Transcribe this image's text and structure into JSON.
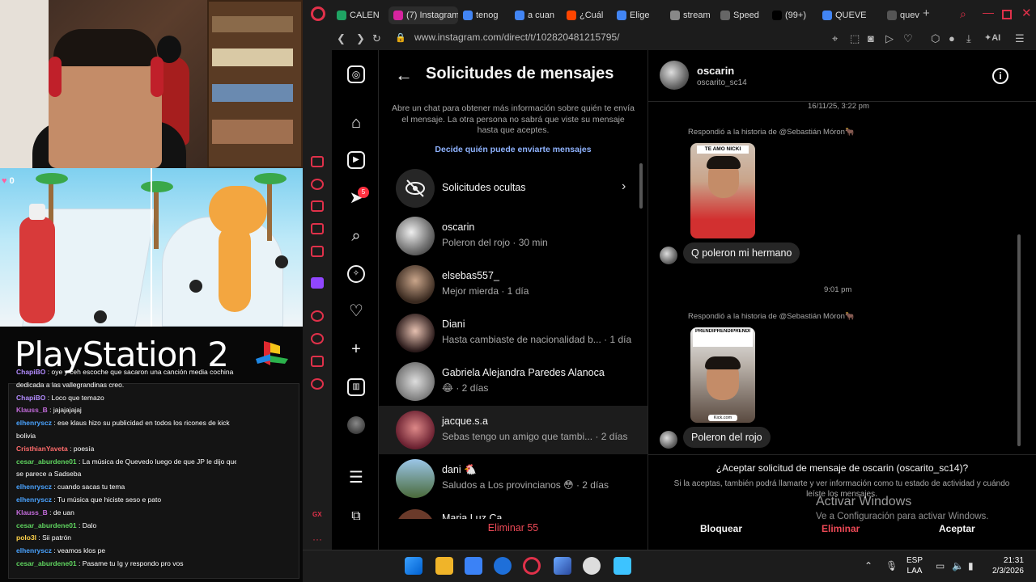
{
  "stream_overlay": {
    "game_counter": "0",
    "ps2_logo_text": "PlayStation 2",
    "chat": [
      {
        "user": "ChapiBO",
        "text": "oye y ceh escoche que sacaron una canción media cochina",
        "color": "#b38cff"
      },
      {
        "user": "",
        "text": "dedicada a las vallegrandinas creo.",
        "color": "#b38cff"
      },
      {
        "user": "ChapiBO",
        "text": "Loco que temazo",
        "color": "#b38cff"
      },
      {
        "user": "Klauss_B",
        "text": "jajajajajaj",
        "color": "#c26bd9"
      },
      {
        "user": "elhenryscz",
        "text": "ese klaus hizo su publicidad en todos los ricones de kick",
        "color": "#4aa3ff"
      },
      {
        "user": "",
        "text": "bolivia",
        "color": "#4aa3ff"
      },
      {
        "user": "CristhianYaveta",
        "text": "poesía",
        "color": "#ff6b6b"
      },
      {
        "user": "cesar_aburdene01",
        "text": "La música de Quevedo luego de que JP le dijo que",
        "color": "#5fd35f"
      },
      {
        "user": "",
        "text": "se parece a Sadseba",
        "color": "#5fd35f"
      },
      {
        "user": "elhenryscz",
        "text": "cuando sacas tu tema",
        "color": "#4aa3ff"
      },
      {
        "user": "elhenryscz",
        "text": "Tu música que hiciste seso e pato",
        "color": "#4aa3ff"
      },
      {
        "user": "Klauss_B",
        "text": "de uan",
        "color": "#c26bd9"
      },
      {
        "user": "cesar_aburdene01",
        "text": "Dalo",
        "color": "#5fd35f"
      },
      {
        "user": "polo3l",
        "text": "Sii patrón",
        "color": "#ffd24a"
      },
      {
        "user": "elhenryscz",
        "text": "veamos klos pe",
        "color": "#4aa3ff"
      },
      {
        "user": "cesar_aburdene01",
        "text": "Pasame tu Ig y respondo pro vos",
        "color": "#5fd35f"
      }
    ]
  },
  "browser": {
    "tabs": [
      {
        "label": "CALEN",
        "color": "#1fa463"
      },
      {
        "label": "(7) Instagram",
        "color": "#d6249f",
        "active": true
      },
      {
        "label": "tenog",
        "color": "#4285f4"
      },
      {
        "label": "a cuan",
        "color": "#4285f4"
      },
      {
        "label": "¿Cuál",
        "color": "#ff4500"
      },
      {
        "label": "Elige",
        "color": "#4285f4"
      },
      {
        "label": "stream",
        "color": "#888888"
      },
      {
        "label": "Speed",
        "color": "#666666"
      },
      {
        "label": "(99+)",
        "color": "#000000"
      },
      {
        "label": "QUEVE",
        "color": "#4285f4"
      },
      {
        "label": "queve",
        "color": "#555555"
      }
    ],
    "url": "www.instagram.com/direct/t/102820481215795/",
    "ai_label": "AI"
  },
  "instagram": {
    "notif_badge": "5",
    "requests": {
      "title": "Solicitudes de mensajes",
      "description": "Abre un chat para obtener más información sobre quién te envía el mensaje. La otra persona no sabrá que viste su mensaje hasta que aceptes.",
      "settings_link": "Decide quién puede enviarte mensajes",
      "hidden_label": "Solicitudes ocultas",
      "items": [
        {
          "name": "oscarin",
          "preview": "Poleron del rojo · 30 min",
          "avatar": "radial-gradient(circle at 40% 40%,#eee,#777 55%,#222)"
        },
        {
          "name": "elsebas557_",
          "preview": "Mejor mierda · 1 día",
          "avatar": "radial-gradient(circle at 50% 40%,#c9a58a,#3a2a20 70%)"
        },
        {
          "name": "Diani",
          "preview": "Hasta cambiaste de nacionalidad b... · 1 día",
          "avatar": "radial-gradient(circle at 50% 45%,#e6c0b0,#2a1a1a 70%)"
        },
        {
          "name": "Gabriela Alejandra Paredes Alanoca",
          "preview": "😂 · 2 días",
          "avatar": "radial-gradient(circle at 50% 50%,#ddd,#888 60%,#444)"
        },
        {
          "name": "jacque.s.a",
          "preview": "Sebas tengo un amigo que tambi... · 2 días",
          "avatar": "radial-gradient(circle at 50% 45%,#d88,#6a2030 70%)",
          "selected": true
        },
        {
          "name": "dani 🐔",
          "preview": "Saludos a Los provincianos 😳 · 2 días",
          "avatar": "linear-gradient(180deg,#9bc6e8,#4a6a3a)"
        }
      ],
      "partial_next": "Maria Luz Ca...",
      "delete_all": "Eliminar 55"
    },
    "conversation": {
      "name": "oscarin",
      "username": "oscarito_sc14",
      "timestamp1": "16/11/25, 3:22 pm",
      "replied1": "Respondió a la historia de @Sebastián Móron🐂",
      "story1_caption": "TE AMO NICKI",
      "message1": "Q poleron mi hermano",
      "timestamp2": "9:01 pm",
      "replied2": "Respondió a la historia de @Sebastián Móron🐂",
      "story2_caption": "PRENDIPRENDIPRENDI",
      "story2_watermark": "Kick.com",
      "message2": "Poleron del rojo",
      "accept_question": "¿Aceptar solicitud de mensaje de oscarin (oscarito_sc14)?",
      "accept_description": "Si la aceptas, también podrá llamarte y ver información como tu estado de actividad y cuándo leíste los mensajes.",
      "block": "Bloquear",
      "delete": "Eliminar",
      "accept": "Aceptar"
    }
  },
  "windows": {
    "activate_title": "Activar Windows",
    "activate_subtitle": "Ve a Configuración para activar Windows.",
    "lang1": "ESP",
    "lang2": "LAA",
    "time": "21:31",
    "date": "2/3/2026"
  }
}
